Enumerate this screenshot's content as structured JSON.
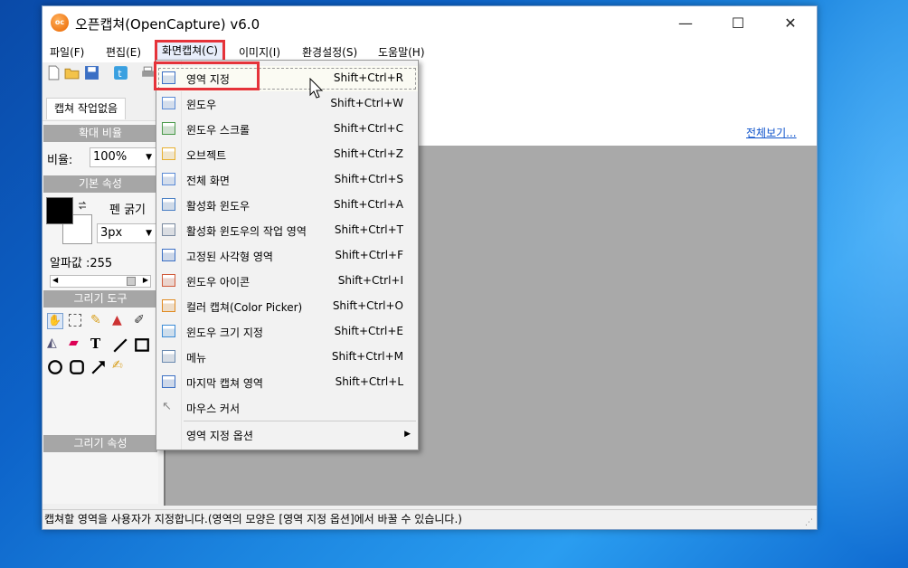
{
  "window": {
    "title": "오픈캡쳐(OpenCapture) v6.0",
    "icon_text": "oc",
    "minimize_glyph": "—",
    "maximize_glyph": "☐",
    "close_glyph": "✕"
  },
  "menu": {
    "file": "파일(F)",
    "edit": "편집(E)",
    "capture": "화면캡쳐(C)",
    "image": "이미지(I)",
    "settings": "환경설정(S)",
    "help": "도움말(H)"
  },
  "tab": {
    "label": "캡쳐 작업없음"
  },
  "left": {
    "zoom_header": "확대 비율",
    "ratio_label": "비율:",
    "ratio_value": "100%",
    "basic_header": "기본 속성",
    "pen_label": "펜 굵기",
    "pen_value": "3px",
    "alpha_label": "알파값 :255",
    "draw_tools_header": "그리기 도구",
    "draw_props_header": "그리기 속성",
    "fg_color": "#000000",
    "bg_color": "#ffffff"
  },
  "view_all": "전체보기...",
  "status": "캡쳐할 영역을 사용자가 지정합니다.(영역의 모양은 [영역 지정 옵션]에서 바꿀 수 있습니다.)",
  "dropdown": {
    "items": [
      {
        "label": "영역 지정",
        "shortcut": "Shift+Ctrl+R",
        "icon": "region-select-icon"
      },
      {
        "label": "윈도우",
        "shortcut": "Shift+Ctrl+W",
        "icon": "window-icon"
      },
      {
        "label": "윈도우 스크롤",
        "shortcut": "Shift+Ctrl+C",
        "icon": "window-scroll-icon"
      },
      {
        "label": "오브젝트",
        "shortcut": "Shift+Ctrl+Z",
        "icon": "object-icon"
      },
      {
        "label": "전체 화면",
        "shortcut": "Shift+Ctrl+S",
        "icon": "fullscreen-icon"
      },
      {
        "label": "활성화 윈도우",
        "shortcut": "Shift+Ctrl+A",
        "icon": "active-window-icon"
      },
      {
        "label": "활성화 윈도우의 작업 영역",
        "shortcut": "Shift+Ctrl+T",
        "icon": "active-client-icon"
      },
      {
        "label": "고정된 사각형 영역",
        "shortcut": "Shift+Ctrl+F",
        "icon": "fixed-rect-icon"
      },
      {
        "label": "윈도우 아이콘",
        "shortcut": "Shift+Ctrl+I",
        "icon": "window-icon-capture-icon"
      },
      {
        "label": "컬러 캡쳐(Color Picker)",
        "shortcut": "Shift+Ctrl+O",
        "icon": "color-picker-icon"
      },
      {
        "label": "윈도우 크기 지정",
        "shortcut": "Shift+Ctrl+E",
        "icon": "window-size-icon"
      },
      {
        "label": "메뉴",
        "shortcut": "Shift+Ctrl+M",
        "icon": "menu-icon"
      },
      {
        "label": "마지막 캡쳐 영역",
        "shortcut": "Shift+Ctrl+L",
        "icon": "last-area-icon"
      },
      {
        "label": "마우스 커서",
        "shortcut": "",
        "icon": "mouse-cursor-icon"
      }
    ],
    "submenu_label": "영역 지정 옵션",
    "submenu_arrow": "▶"
  },
  "colors": {
    "highlight": "#e5333a",
    "link": "#1155cc",
    "canvas": "#a9a9a9",
    "section_header": "#a6a6a6"
  }
}
